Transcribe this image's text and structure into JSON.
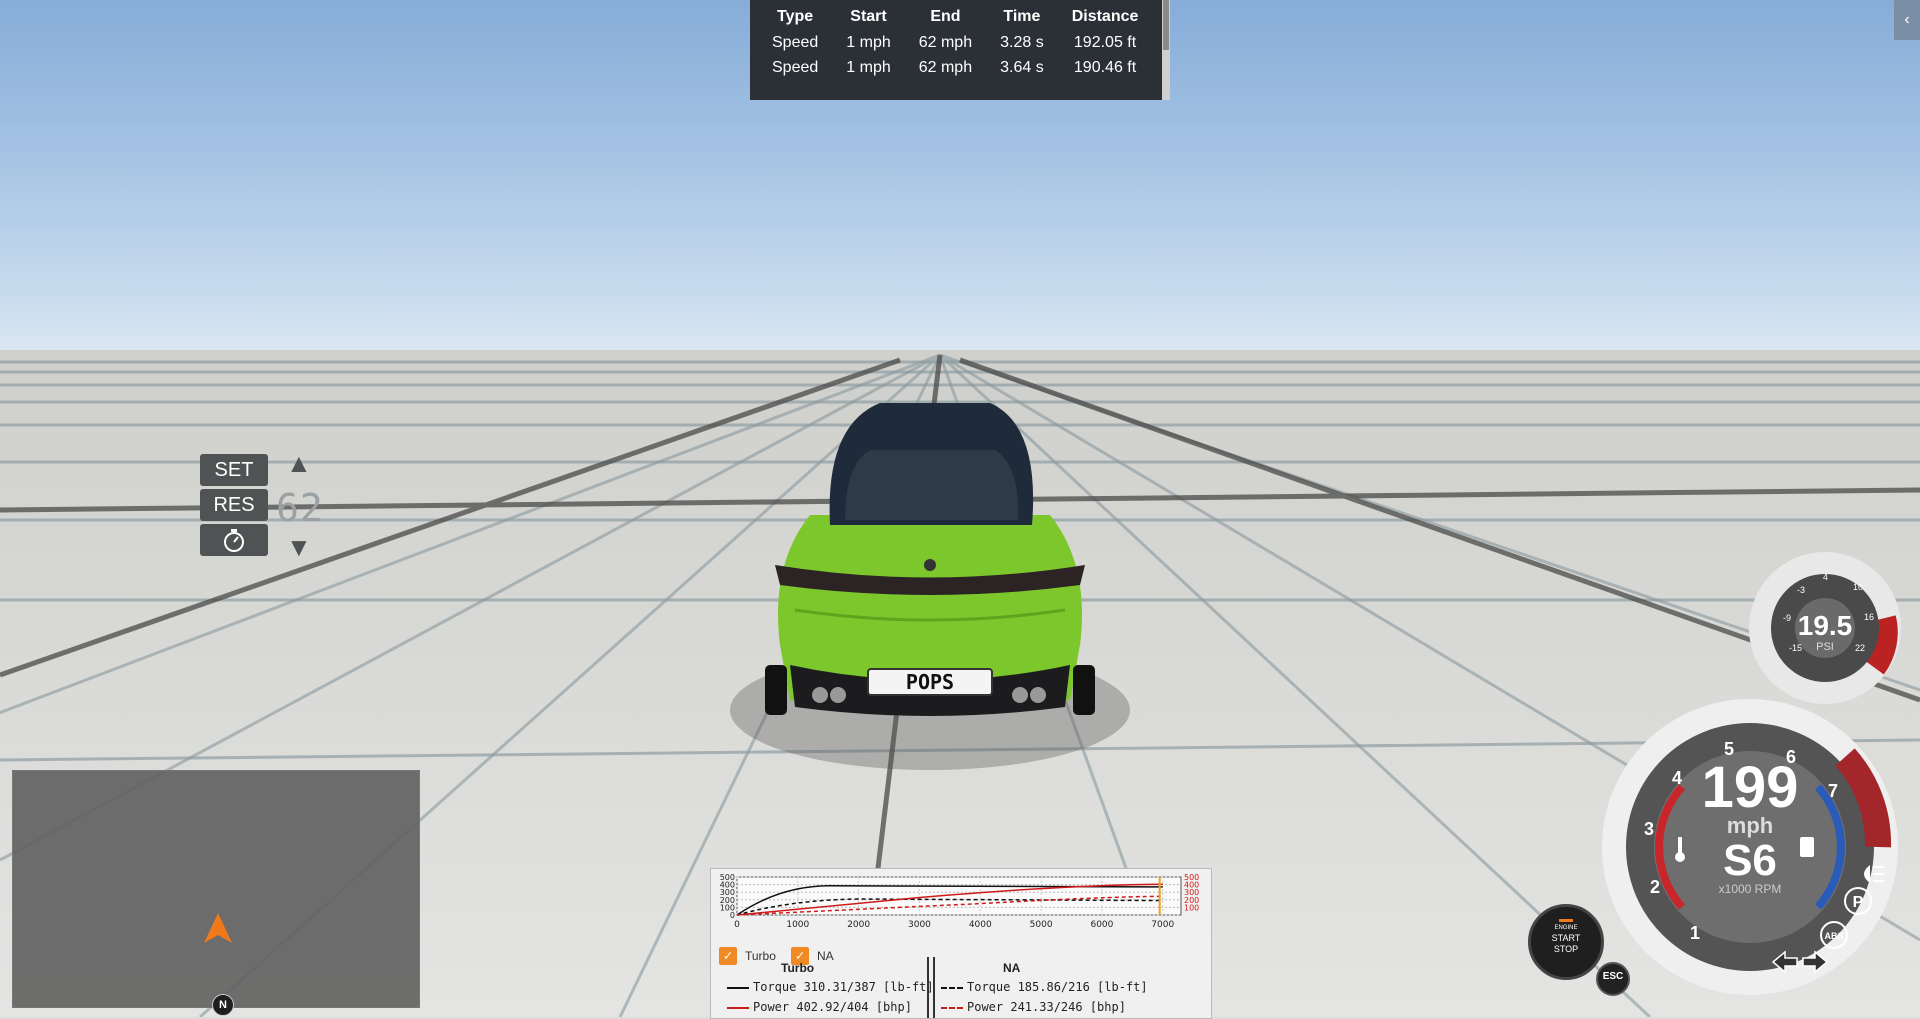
{
  "timing_table": {
    "headers": [
      "Type",
      "Start",
      "End",
      "Time",
      "Distance"
    ],
    "rows": [
      [
        "Speed",
        "1 mph",
        "62 mph",
        "3.28 s",
        "192.05 ft"
      ],
      [
        "Speed",
        "1 mph",
        "62 mph",
        "3.64 s",
        "190.46 ft"
      ]
    ]
  },
  "corner_tab": {
    "label": "‹"
  },
  "cruise_control": {
    "set_label": "SET",
    "res_label": "RES",
    "speed_value": "62",
    "up_icon": "triangle-up-icon",
    "down_icon": "triangle-down-icon",
    "mode_icon": "stopwatch-icon"
  },
  "vehicle": {
    "plate": "POPS",
    "color": "#7cc72b"
  },
  "minimap": {
    "compass_label": "N",
    "marker_color": "#f07a1a"
  },
  "boost_gauge": {
    "value": "19.5",
    "unit": "PSI",
    "ticks": [
      "-15",
      "-9",
      "-3",
      "4",
      "10",
      "16",
      "22"
    ]
  },
  "speedometer": {
    "speed": "199",
    "speed_unit": "mph",
    "gear": "S6",
    "rpm_label": "x1000 RPM",
    "rpm_ticks": [
      "1",
      "2",
      "3",
      "4",
      "5",
      "6",
      "7"
    ],
    "redline_color": "#c8262b",
    "temp_bar_color": "#c8262b",
    "fuel_bar_color": "#2a5bb8"
  },
  "indicators": {
    "abs_label": "ABS",
    "parking_label": "P",
    "esc_label": "ESC",
    "engine_button": {
      "line1": "ENGINE",
      "line2": "START",
      "line3": "STOP"
    }
  },
  "dyno": {
    "y_ticks_left": [
      "500",
      "400",
      "300",
      "200",
      "100",
      "0"
    ],
    "y_ticks_right": [
      "500",
      "400",
      "300",
      "200",
      "100"
    ],
    "x_ticks": [
      "0",
      "1000",
      "2000",
      "3000",
      "4000",
      "5000",
      "6000",
      "7000"
    ],
    "turbo_checkbox_label": "Turbo",
    "na_checkbox_label": "NA",
    "turbo": {
      "title": "Turbo",
      "torque": "Torque 310.31/387 [lb-ft]",
      "power": "Power  402.92/404 [bhp]"
    },
    "na": {
      "title": "NA",
      "torque": "Torque 185.86/216 [lb-ft]",
      "power": "Power  241.33/246 [bhp]"
    },
    "colors": {
      "torque": "#111111",
      "power": "#d01a1a",
      "marker": "#f0a020"
    }
  }
}
